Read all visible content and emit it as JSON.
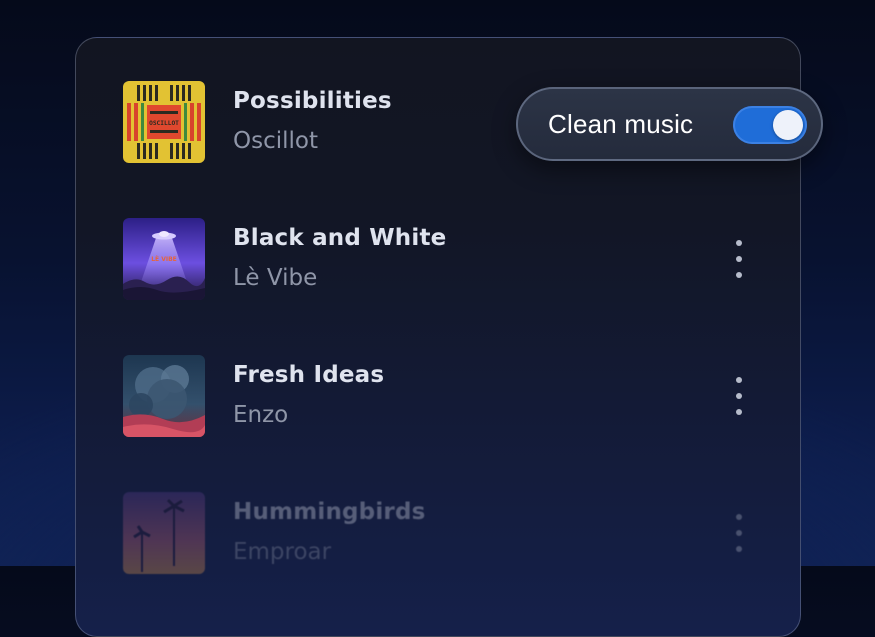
{
  "clean_music": {
    "label": "Clean music",
    "enabled": true,
    "accent": "#1f6dd8"
  },
  "tracks": [
    {
      "title": "Possibilities",
      "artist": "Oscillot",
      "art_text": "OSCILLOT",
      "art_colors": [
        "#e2c233",
        "#d8432c",
        "#3f8a3e"
      ]
    },
    {
      "title": "Black and White",
      "artist": "Lè Vibe",
      "art_text": "LÈ VIBE",
      "art_colors": [
        "#3a2a9c",
        "#7f63e6",
        "#e06a3a"
      ],
      "menu_icon": "more-vertical-icon"
    },
    {
      "title": "Fresh Ideas",
      "artist": "Enzo",
      "art_colors": [
        "#1c3b55",
        "#3d5b77",
        "#c0445a"
      ],
      "menu_icon": "more-vertical-icon"
    },
    {
      "title": "Hummingbirds",
      "artist": "Emproar",
      "art_colors": [
        "#5b3d8f",
        "#c8677a",
        "#e59a4c"
      ],
      "menu_icon": "more-vertical-icon"
    }
  ]
}
